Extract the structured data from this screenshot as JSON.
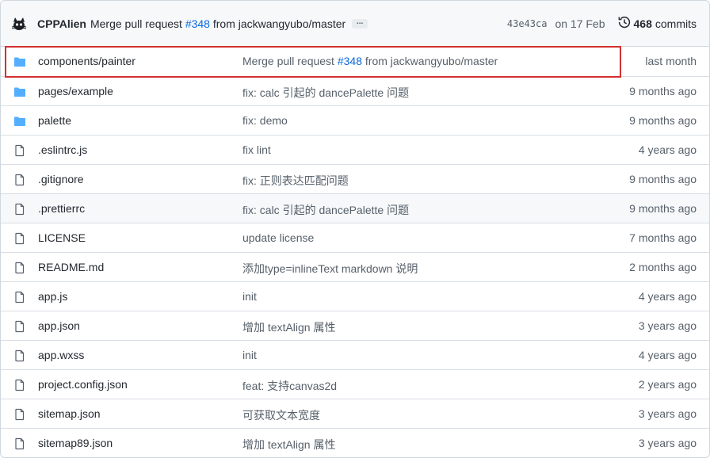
{
  "latest_commit": {
    "author": "CPPAlien",
    "message_prefix": "Merge pull request ",
    "pr_number": "#348",
    "message_suffix": " from jackwangyubo/master",
    "ellipsis": "...",
    "sha": "43e43ca",
    "date": "on 17 Feb",
    "commit_count": "468",
    "commits_label": "commits",
    "history_icon": "history-icon",
    "avatar_icon": "cat-avatar-icon"
  },
  "highlight_color": "#d32f2f",
  "files": [
    {
      "name": "components/painter",
      "type": "folder",
      "message": "Merge pull request ",
      "message_link": "#348",
      "message_tail": " from jackwangyubo/master",
      "age": "last month"
    },
    {
      "name": "pages/example",
      "type": "folder",
      "message": "fix: calc 引起的 dancePalette 问题",
      "age": "9 months ago"
    },
    {
      "name": "palette",
      "type": "folder",
      "message": "fix: demo",
      "age": "9 months ago"
    },
    {
      "name": ".eslintrc.js",
      "type": "file",
      "message": "fix lint",
      "age": "4 years ago"
    },
    {
      "name": ".gitignore",
      "type": "file",
      "message": "fix: 正则表达匹配问题",
      "age": "9 months ago"
    },
    {
      "name": ".prettierrc",
      "type": "file",
      "message": "fix: calc 引起的 dancePalette 问题",
      "age": "9 months ago"
    },
    {
      "name": "LICENSE",
      "type": "file",
      "message": "update license",
      "age": "7 months ago"
    },
    {
      "name": "README.md",
      "type": "file",
      "message": "添加type=inlineText markdown 说明",
      "age": "2 months ago"
    },
    {
      "name": "app.js",
      "type": "file",
      "message": "init",
      "age": "4 years ago"
    },
    {
      "name": "app.json",
      "type": "file",
      "message": "增加 textAlign 属性",
      "age": "3 years ago"
    },
    {
      "name": "app.wxss",
      "type": "file",
      "message": "init",
      "age": "4 years ago"
    },
    {
      "name": "project.config.json",
      "type": "file",
      "message": "feat: 支持canvas2d",
      "age": "2 years ago"
    },
    {
      "name": "sitemap.json",
      "type": "file",
      "message": "可获取文本宽度",
      "age": "3 years ago"
    },
    {
      "name": "sitemap89.json",
      "type": "file",
      "message": "增加 textAlign 属性",
      "age": "3 years ago"
    }
  ]
}
